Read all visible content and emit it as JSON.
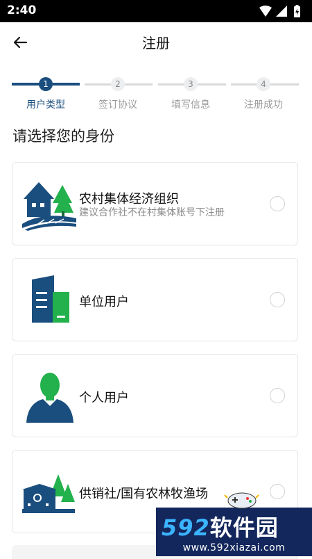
{
  "status_bar": {
    "time": "2:40"
  },
  "app_bar": {
    "title": "注册"
  },
  "stepper": {
    "steps": [
      {
        "number": "1",
        "label": "用户类型"
      },
      {
        "number": "2",
        "label": "签订协议"
      },
      {
        "number": "3",
        "label": "填写信息"
      },
      {
        "number": "4",
        "label": "注册成功"
      }
    ]
  },
  "section_title": "请选择您的身份",
  "options": [
    {
      "name": "农村集体经济组织",
      "desc": "建议合作社不在村集体账号下注册"
    },
    {
      "name": "单位用户"
    },
    {
      "name": "个人用户"
    },
    {
      "name": "供销社/国有农林牧渔场"
    }
  ],
  "colors": {
    "primary": "#1a4e7e",
    "green": "#22b14c"
  },
  "watermark": {
    "brand": "592",
    "brand_cn": "软件园",
    "url": "www.592xiazai.com"
  }
}
